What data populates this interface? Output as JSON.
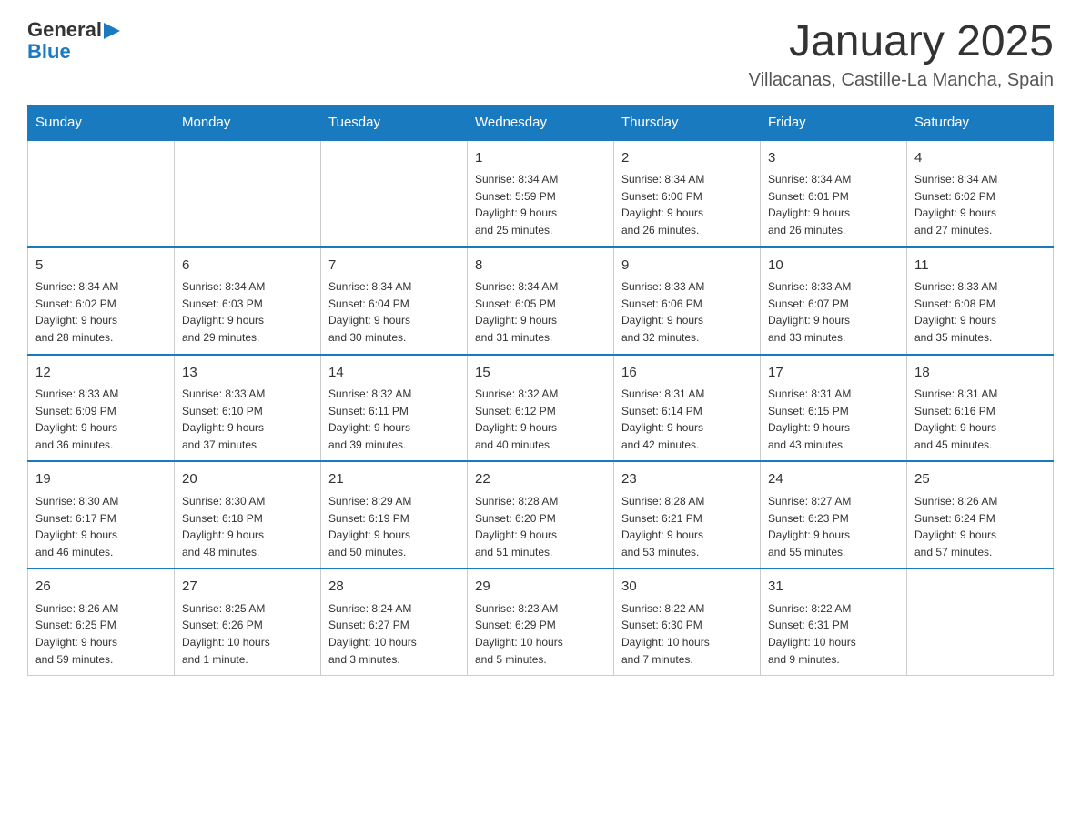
{
  "header": {
    "logo": {
      "general": "General",
      "triangle": "▶",
      "blue": "Blue"
    },
    "title": "January 2025",
    "location": "Villacanas, Castille-La Mancha, Spain"
  },
  "days_of_week": [
    "Sunday",
    "Monday",
    "Tuesday",
    "Wednesday",
    "Thursday",
    "Friday",
    "Saturday"
  ],
  "weeks": [
    [
      {
        "day": "",
        "info": ""
      },
      {
        "day": "",
        "info": ""
      },
      {
        "day": "",
        "info": ""
      },
      {
        "day": "1",
        "info": "Sunrise: 8:34 AM\nSunset: 5:59 PM\nDaylight: 9 hours\nand 25 minutes."
      },
      {
        "day": "2",
        "info": "Sunrise: 8:34 AM\nSunset: 6:00 PM\nDaylight: 9 hours\nand 26 minutes."
      },
      {
        "day": "3",
        "info": "Sunrise: 8:34 AM\nSunset: 6:01 PM\nDaylight: 9 hours\nand 26 minutes."
      },
      {
        "day": "4",
        "info": "Sunrise: 8:34 AM\nSunset: 6:02 PM\nDaylight: 9 hours\nand 27 minutes."
      }
    ],
    [
      {
        "day": "5",
        "info": "Sunrise: 8:34 AM\nSunset: 6:02 PM\nDaylight: 9 hours\nand 28 minutes."
      },
      {
        "day": "6",
        "info": "Sunrise: 8:34 AM\nSunset: 6:03 PM\nDaylight: 9 hours\nand 29 minutes."
      },
      {
        "day": "7",
        "info": "Sunrise: 8:34 AM\nSunset: 6:04 PM\nDaylight: 9 hours\nand 30 minutes."
      },
      {
        "day": "8",
        "info": "Sunrise: 8:34 AM\nSunset: 6:05 PM\nDaylight: 9 hours\nand 31 minutes."
      },
      {
        "day": "9",
        "info": "Sunrise: 8:33 AM\nSunset: 6:06 PM\nDaylight: 9 hours\nand 32 minutes."
      },
      {
        "day": "10",
        "info": "Sunrise: 8:33 AM\nSunset: 6:07 PM\nDaylight: 9 hours\nand 33 minutes."
      },
      {
        "day": "11",
        "info": "Sunrise: 8:33 AM\nSunset: 6:08 PM\nDaylight: 9 hours\nand 35 minutes."
      }
    ],
    [
      {
        "day": "12",
        "info": "Sunrise: 8:33 AM\nSunset: 6:09 PM\nDaylight: 9 hours\nand 36 minutes."
      },
      {
        "day": "13",
        "info": "Sunrise: 8:33 AM\nSunset: 6:10 PM\nDaylight: 9 hours\nand 37 minutes."
      },
      {
        "day": "14",
        "info": "Sunrise: 8:32 AM\nSunset: 6:11 PM\nDaylight: 9 hours\nand 39 minutes."
      },
      {
        "day": "15",
        "info": "Sunrise: 8:32 AM\nSunset: 6:12 PM\nDaylight: 9 hours\nand 40 minutes."
      },
      {
        "day": "16",
        "info": "Sunrise: 8:31 AM\nSunset: 6:14 PM\nDaylight: 9 hours\nand 42 minutes."
      },
      {
        "day": "17",
        "info": "Sunrise: 8:31 AM\nSunset: 6:15 PM\nDaylight: 9 hours\nand 43 minutes."
      },
      {
        "day": "18",
        "info": "Sunrise: 8:31 AM\nSunset: 6:16 PM\nDaylight: 9 hours\nand 45 minutes."
      }
    ],
    [
      {
        "day": "19",
        "info": "Sunrise: 8:30 AM\nSunset: 6:17 PM\nDaylight: 9 hours\nand 46 minutes."
      },
      {
        "day": "20",
        "info": "Sunrise: 8:30 AM\nSunset: 6:18 PM\nDaylight: 9 hours\nand 48 minutes."
      },
      {
        "day": "21",
        "info": "Sunrise: 8:29 AM\nSunset: 6:19 PM\nDaylight: 9 hours\nand 50 minutes."
      },
      {
        "day": "22",
        "info": "Sunrise: 8:28 AM\nSunset: 6:20 PM\nDaylight: 9 hours\nand 51 minutes."
      },
      {
        "day": "23",
        "info": "Sunrise: 8:28 AM\nSunset: 6:21 PM\nDaylight: 9 hours\nand 53 minutes."
      },
      {
        "day": "24",
        "info": "Sunrise: 8:27 AM\nSunset: 6:23 PM\nDaylight: 9 hours\nand 55 minutes."
      },
      {
        "day": "25",
        "info": "Sunrise: 8:26 AM\nSunset: 6:24 PM\nDaylight: 9 hours\nand 57 minutes."
      }
    ],
    [
      {
        "day": "26",
        "info": "Sunrise: 8:26 AM\nSunset: 6:25 PM\nDaylight: 9 hours\nand 59 minutes."
      },
      {
        "day": "27",
        "info": "Sunrise: 8:25 AM\nSunset: 6:26 PM\nDaylight: 10 hours\nand 1 minute."
      },
      {
        "day": "28",
        "info": "Sunrise: 8:24 AM\nSunset: 6:27 PM\nDaylight: 10 hours\nand 3 minutes."
      },
      {
        "day": "29",
        "info": "Sunrise: 8:23 AM\nSunset: 6:29 PM\nDaylight: 10 hours\nand 5 minutes."
      },
      {
        "day": "30",
        "info": "Sunrise: 8:22 AM\nSunset: 6:30 PM\nDaylight: 10 hours\nand 7 minutes."
      },
      {
        "day": "31",
        "info": "Sunrise: 8:22 AM\nSunset: 6:31 PM\nDaylight: 10 hours\nand 9 minutes."
      },
      {
        "day": "",
        "info": ""
      }
    ]
  ]
}
